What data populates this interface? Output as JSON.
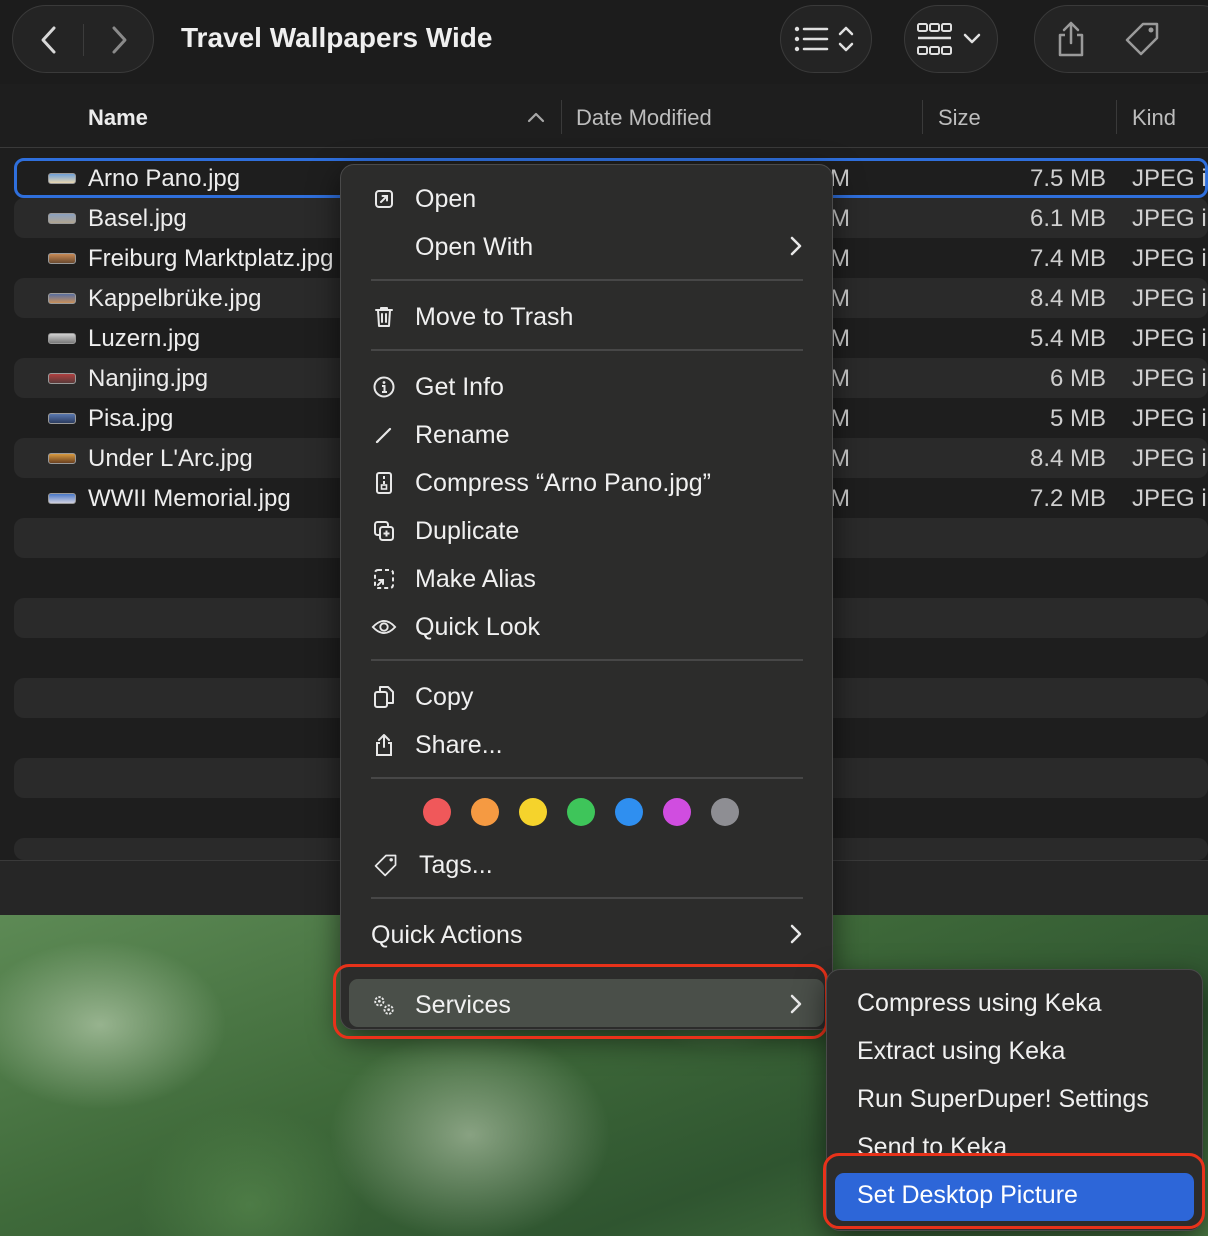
{
  "window": {
    "title": "Travel Wallpapers Wide"
  },
  "columns": {
    "name": "Name",
    "date_modified": "Date Modified",
    "size": "Size",
    "kind": "Kind"
  },
  "files": [
    {
      "name": "Arno Pano.jpg",
      "date": "M",
      "size": "7.5 MB",
      "kind": "JPEG in"
    },
    {
      "name": "Basel.jpg",
      "date": "M",
      "size": "6.1 MB",
      "kind": "JPEG in"
    },
    {
      "name": "Freiburg Marktplatz.jpg",
      "date": "M",
      "size": "7.4 MB",
      "kind": "JPEG in"
    },
    {
      "name": "Kappelbrüke.jpg",
      "date": "M",
      "size": "8.4 MB",
      "kind": "JPEG in"
    },
    {
      "name": "Luzern.jpg",
      "date": "M",
      "size": "5.4 MB",
      "kind": "JPEG in"
    },
    {
      "name": "Nanjing.jpg",
      "date": "M",
      "size": "6 MB",
      "kind": "JPEG in"
    },
    {
      "name": "Pisa.jpg",
      "date": "M",
      "size": "5 MB",
      "kind": "JPEG in"
    },
    {
      "name": "Under L'Arc.jpg",
      "date": "M",
      "size": "8.4 MB",
      "kind": "JPEG in"
    },
    {
      "name": "WWII Memorial.jpg",
      "date": "M",
      "size": "7.2 MB",
      "kind": "JPEG in"
    }
  ],
  "context_menu": {
    "open": "Open",
    "open_with": "Open With",
    "move_to_trash": "Move to Trash",
    "get_info": "Get Info",
    "rename": "Rename",
    "compress": "Compress “Arno Pano.jpg”",
    "duplicate": "Duplicate",
    "make_alias": "Make Alias",
    "quick_look": "Quick Look",
    "copy": "Copy",
    "share": "Share...",
    "tags": "Tags...",
    "quick_actions": "Quick Actions",
    "services": "Services",
    "tag_colors": [
      "#f0585a",
      "#f59a42",
      "#f5d32c",
      "#3ec55a",
      "#2f8ff0",
      "#d04de0",
      "#8e8e93"
    ]
  },
  "services_submenu": {
    "items": [
      "Compress using Keka",
      "Extract using Keka",
      "Run SuperDuper! Settings",
      "Send to Keka",
      "Set Desktop Picture"
    ]
  }
}
